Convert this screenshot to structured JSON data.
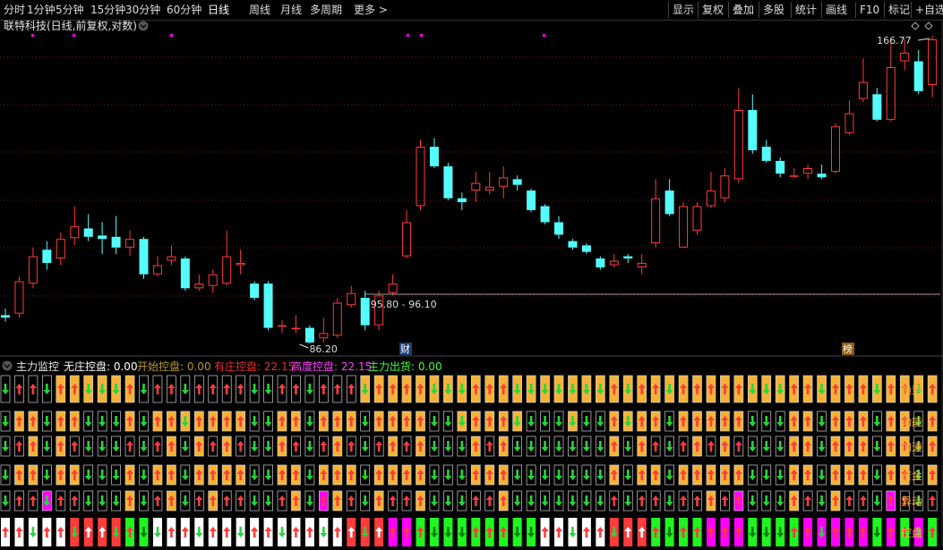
{
  "toolbar": {
    "left_items": [
      "分时",
      "1分钟",
      "5分钟",
      "15分钟",
      "30分钟",
      "60分钟",
      "日线",
      "周线",
      "月线",
      "多周期",
      "更多 >"
    ],
    "active": "日线",
    "right_items": [
      "显示",
      "复权",
      "叠加",
      "多股",
      "统计",
      "画线",
      "F10",
      "标记",
      "+自选"
    ]
  },
  "main_panel": {
    "title": "联特科技(日线,前复权,对数)",
    "high_label": "166.77",
    "low_label": "86.20",
    "range_label": "95.80 - 96.10",
    "marker_cai": "财",
    "marker_bang": "榜"
  },
  "indicator_panel": {
    "name": "主力监控",
    "items": [
      {
        "label": "无庄控盘:",
        "value": "0.00",
        "color": "#ffffff"
      },
      {
        "label": "开始控盘:",
        "value": "0.00",
        "color": "#b59a2d"
      },
      {
        "label": "有庄控盘:",
        "value": "22.15",
        "color": "#e03030"
      },
      {
        "label": "高度控盘:",
        "value": "22.15",
        "color": "#ff40ff"
      },
      {
        "label": "主力出货:",
        "value": "0.00",
        "color": "#40ff40"
      }
    ],
    "row_labels": [
      "趋势",
      "动能",
      "加速",
      "资金",
      "异动",
      "控盘"
    ]
  },
  "colors": {
    "up": "#ff3b3b",
    "down": "#54fcfc",
    "orange": "#f6b236",
    "green": "#26d63a",
    "magenta": "#ff00ff",
    "white": "#ffffff"
  },
  "chart_data": {
    "type": "candlestick",
    "title": "联特科技(日线,前复权,对数)",
    "scale": "log",
    "annotations": {
      "high": 166.77,
      "low": 86.2,
      "range": [
        95.8,
        96.1
      ]
    },
    "candles": [
      [
        91.5,
        91.0,
        92.8,
        90.2
      ],
      [
        91.8,
        98.5,
        99.5,
        91.0
      ],
      [
        98.0,
        104.0,
        106.0,
        97.0
      ],
      [
        105.5,
        102.5,
        107.5,
        101.0
      ],
      [
        103.5,
        108.0,
        109.5,
        102.0
      ],
      [
        108.2,
        111.0,
        116.0,
        106.5
      ],
      [
        110.5,
        108.5,
        114.0,
        107.5
      ],
      [
        108.8,
        108.0,
        112.0,
        104.5
      ],
      [
        108.5,
        106.0,
        113.5,
        104.5
      ],
      [
        106.0,
        108.0,
        110.0,
        104.0
      ],
      [
        108.0,
        100.0,
        108.5,
        99.0
      ],
      [
        100.0,
        102.0,
        104.0,
        99.5
      ],
      [
        103.0,
        104.0,
        106.5,
        102.0
      ],
      [
        103.5,
        97.0,
        104.0,
        96.5
      ],
      [
        97.0,
        98.0,
        100.0,
        96.5
      ],
      [
        97.5,
        100.0,
        101.0,
        96.0
      ],
      [
        98.0,
        104.0,
        110.0,
        97.5
      ],
      [
        102.0,
        102.5,
        105.5,
        100.0
      ],
      [
        98.0,
        95.0,
        98.5,
        94.5
      ],
      [
        98.0,
        89.0,
        98.5,
        88.5
      ],
      [
        89.5,
        89.5,
        90.5,
        88.0
      ],
      [
        89.0,
        89.0,
        91.5,
        88.0
      ],
      [
        89.0,
        86.2,
        89.5,
        86.0
      ],
      [
        87.0,
        88.0,
        91.0,
        86.2
      ],
      [
        87.5,
        94.0,
        95.0,
        87.0
      ],
      [
        93.5,
        96.0,
        97.5,
        93.0
      ],
      [
        95.0,
        89.5,
        96.5,
        88.5
      ],
      [
        89.5,
        95.5,
        96.5,
        88.5
      ],
      [
        96.0,
        98.0,
        100.0,
        95.5
      ],
      [
        104.0,
        112.0,
        115.0,
        103.5
      ],
      [
        116.0,
        132.0,
        134.0,
        115.0
      ],
      [
        132.0,
        126.5,
        134.5,
        126.0
      ],
      [
        126.5,
        118.0,
        127.5,
        117.5
      ],
      [
        118.0,
        117.0,
        119.5,
        115.0
      ],
      [
        120.0,
        122.0,
        125.0,
        117.0
      ],
      [
        120.0,
        121.0,
        125.0,
        119.0
      ],
      [
        121.0,
        123.5,
        126.5,
        118.0
      ],
      [
        123.0,
        121.5,
        124.0,
        120.0
      ],
      [
        120.0,
        115.0,
        120.5,
        114.5
      ],
      [
        116.0,
        112.0,
        116.5,
        111.5
      ],
      [
        112.0,
        109.0,
        113.5,
        108.0
      ],
      [
        107.5,
        106.0,
        108.0,
        105.5
      ],
      [
        106.5,
        105.0,
        107.0,
        104.5
      ],
      [
        103.5,
        101.5,
        104.0,
        101.0
      ],
      [
        102.0,
        103.0,
        104.5,
        101.5
      ],
      [
        104.0,
        103.5,
        104.5,
        102.5
      ],
      [
        101.5,
        102.5,
        104.5,
        100.0
      ],
      [
        107.0,
        118.0,
        123.0,
        106.0
      ],
      [
        120.0,
        114.0,
        123.0,
        113.5
      ],
      [
        106.0,
        116.0,
        117.0,
        106.0
      ],
      [
        110.0,
        116.0,
        117.0,
        109.0
      ],
      [
        116.0,
        120.0,
        125.0,
        115.5
      ],
      [
        118.0,
        124.0,
        126.0,
        117.0
      ],
      [
        123.0,
        143.0,
        150.0,
        122.0
      ],
      [
        143.0,
        131.0,
        148.0,
        130.0
      ],
      [
        132.0,
        128.0,
        134.0,
        127.5
      ],
      [
        128.0,
        124.5,
        129.0,
        123.5
      ],
      [
        124.0,
        124.0,
        126.0,
        123.5
      ],
      [
        124.5,
        126.0,
        127.0,
        123.0
      ],
      [
        124.5,
        123.5,
        127.0,
        123.0
      ],
      [
        125.0,
        138.0,
        139.0,
        124.5
      ],
      [
        136.0,
        142.0,
        146.0,
        135.5
      ],
      [
        146.5,
        152.0,
        160.0,
        145.5
      ],
      [
        148.0,
        140.0,
        150.0,
        139.5
      ],
      [
        140.0,
        157.0,
        167.0,
        139.5
      ],
      [
        159.0,
        162.0,
        167.0,
        156.0
      ],
      [
        159.0,
        149.0,
        163.0,
        148.0
      ],
      [
        151.0,
        166.77,
        168.0,
        147.0
      ]
    ]
  }
}
